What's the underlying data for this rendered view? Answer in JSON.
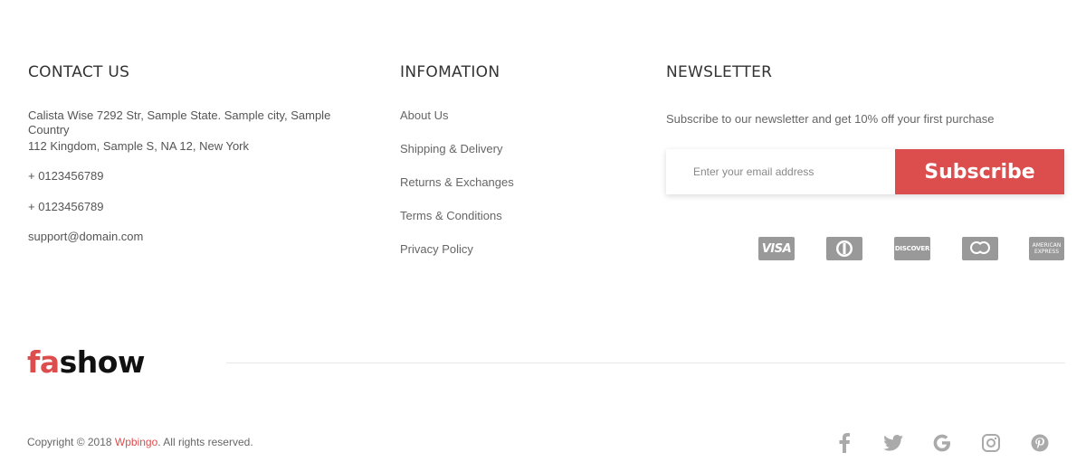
{
  "contact": {
    "title": "CONTACT US",
    "lines": [
      "Calista Wise 7292 Str, Sample State. Sample city, Sample Country",
      "112 Kingdom, Sample S, NA 12, New York",
      "+ 0123456789",
      "+ 0123456789",
      "support@domain.com"
    ]
  },
  "info": {
    "title": "INFOMATION",
    "links": [
      "About Us",
      "Shipping & Delivery",
      "Returns & Exchanges",
      "Terms & Conditions",
      "Privacy Policy"
    ]
  },
  "newsletter": {
    "title": "NEWSLETTER",
    "description": "Subscribe to our newsletter and get 10% off your first purchase",
    "email_placeholder": "Enter your email address",
    "subscribe_label": "Subscribe"
  },
  "payment_cards": {
    "visa": "VISA",
    "discover": "DISCOVER",
    "amex": "AMERICAN EXPRESS",
    "icons": [
      "visa-icon",
      "diners-club-icon",
      "discover-icon",
      "mastercard-icon",
      "american-express-icon"
    ],
    "color": "#999999"
  },
  "logo": {
    "part1": "fa",
    "part2": "show",
    "accent": "#dc4d4d"
  },
  "footer": {
    "copyright_prefix": "Copyright © 2018 ",
    "brand": "Wpbingo",
    "copyright_suffix": ". All rights reserved."
  },
  "socials": {
    "icons": [
      "facebook-icon",
      "twitter-icon",
      "google-icon",
      "instagram-icon",
      "pinterest-icon"
    ],
    "color": "#aaaaaa"
  }
}
